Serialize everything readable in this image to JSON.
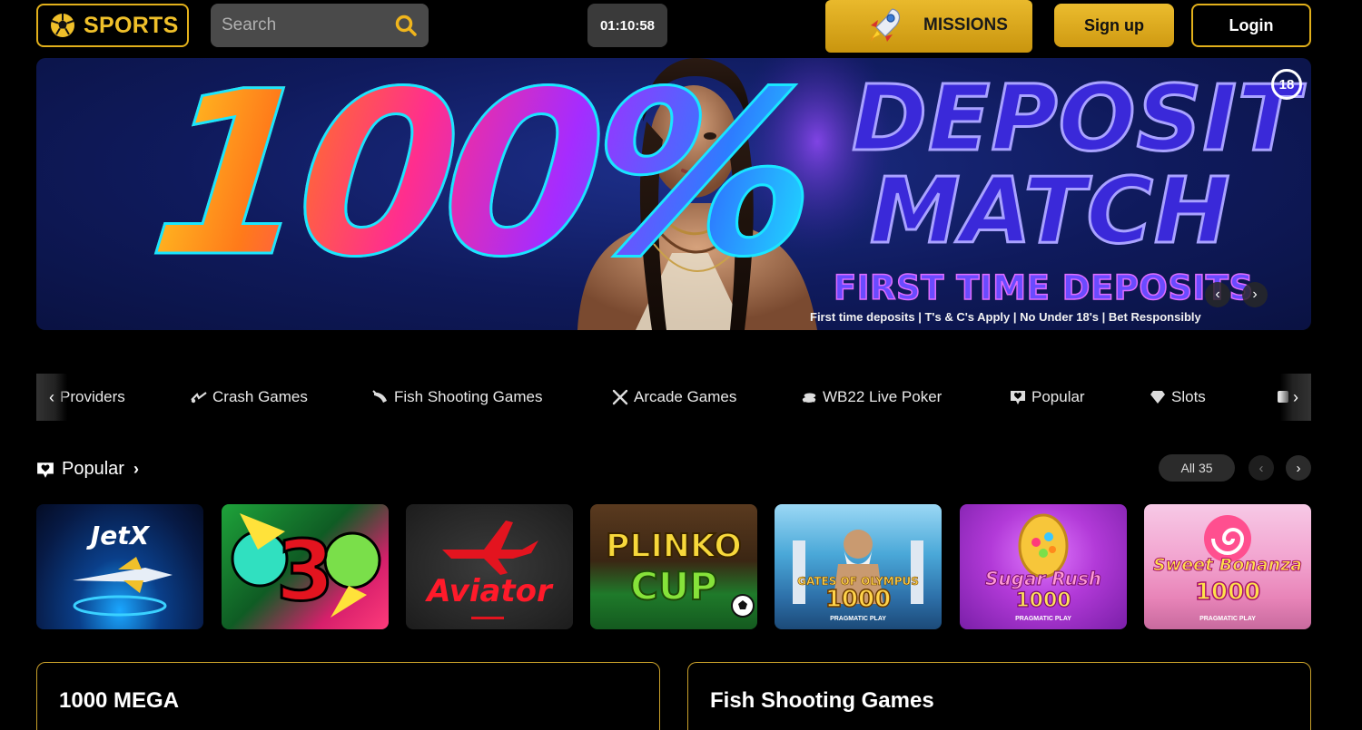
{
  "header": {
    "sports_label": "SPORTS",
    "search_placeholder": "Search",
    "clock": "01:10:58",
    "missions_label": "MISSIONS",
    "signup_label": "Sign up",
    "login_label": "Login"
  },
  "banner": {
    "headline_percent": "100%",
    "headline_line1": "DEPOSIT",
    "headline_line2": "MATCH",
    "headline_line3": "FIRST TIME DEPOSITS",
    "disclaimer": "First time deposits | T's & C's Apply | No Under 18's | Bet Responsibly",
    "age_badge": "18",
    "prev_icon": "chevron-left-icon",
    "next_icon": "chevron-right-icon"
  },
  "categories": [
    {
      "label": "Providers",
      "icon": "providers-icon"
    },
    {
      "label": "Crash Games",
      "icon": "crash-games-icon"
    },
    {
      "label": "Fish Shooting Games",
      "icon": "fish-icon"
    },
    {
      "label": "Arcade Games",
      "icon": "crossed-swords-icon"
    },
    {
      "label": "WB22 Live Poker",
      "icon": "poker-chips-icon"
    },
    {
      "label": "Popular",
      "icon": "heart-badge-icon"
    },
    {
      "label": "Slots",
      "icon": "diamond-icon"
    }
  ],
  "popular": {
    "title": "Popular",
    "all_label": "All",
    "count": "35"
  },
  "games": [
    {
      "title": "JetX"
    },
    {
      "title": "3"
    },
    {
      "title": "Aviator"
    },
    {
      "title": "PLINKO",
      "subtitle": "CUP"
    },
    {
      "title": "GATES OF OLYMPUS",
      "subtitle": "1000",
      "provider": "PRAGMATIC PLAY"
    },
    {
      "title": "Sugar Rush",
      "subtitle": "1000",
      "provider": "PRAGMATIC PLAY"
    },
    {
      "title": "Sweet Bonanza",
      "subtitle": "1000",
      "provider": "PRAGMATIC PLAY"
    }
  ],
  "cards": [
    {
      "title": "1000 MEGA"
    },
    {
      "title": "Fish Shooting Games"
    }
  ],
  "colors": {
    "accent_gold": "#e2b01b",
    "background": "#000000",
    "banner_blue": "#0f1a5c"
  }
}
